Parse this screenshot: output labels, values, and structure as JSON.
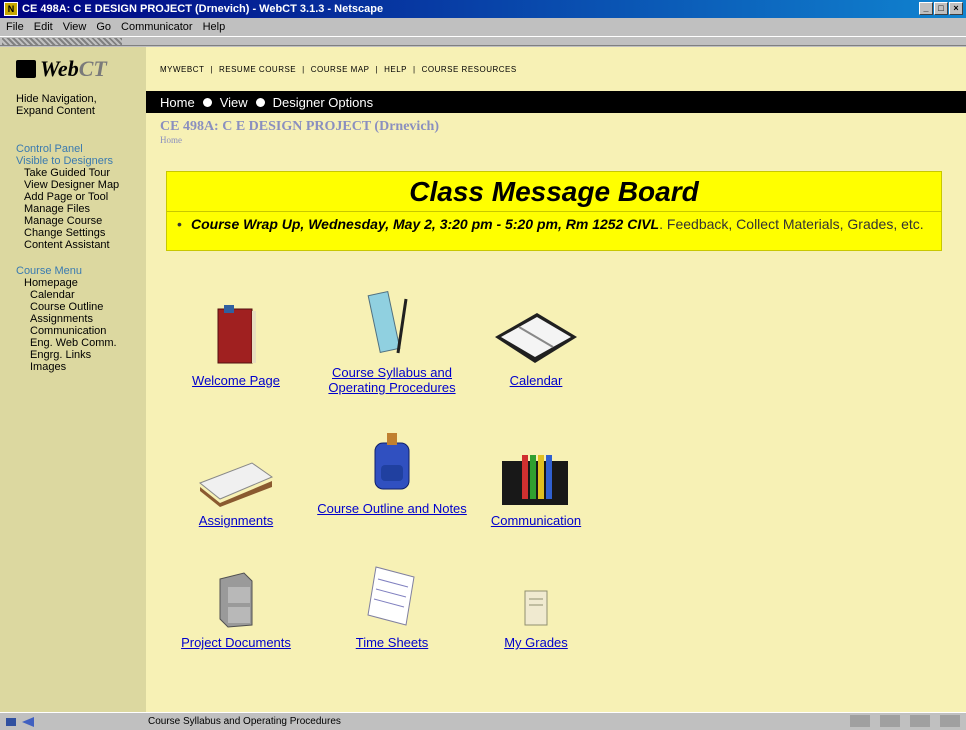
{
  "window": {
    "title": "CE 498A: C E DESIGN PROJECT (Drnevich) - WebCT 3.1.3 - Netscape"
  },
  "menu": [
    "File",
    "Edit",
    "View",
    "Go",
    "Communicator",
    "Help"
  ],
  "logo": {
    "web": "Web",
    "ct": "CT"
  },
  "sidebar": {
    "hide_nav": "Hide Navigation,",
    "expand": "Expand Content",
    "control_panel": "Control Panel",
    "visible": "Visible to Designers",
    "cp_items": [
      "Take Guided Tour",
      "View Designer Map",
      "Add Page or Tool",
      "Manage Files",
      "Manage Course",
      "Change Settings",
      "Content Assistant"
    ],
    "course_menu": "Course Menu",
    "homepage": "Homepage",
    "menu_items": [
      "Calendar",
      "Course Outline",
      "Assignments",
      "Communication",
      "Eng. Web Comm.",
      "Engrg. Links",
      "Images"
    ]
  },
  "topnav": [
    "MYWEBCT",
    "RESUME COURSE",
    "COURSE MAP",
    "HELP",
    "COURSE RESOURCES"
  ],
  "crumbs": {
    "home": "Home",
    "view": "View",
    "designer": "Designer Options"
  },
  "course": {
    "title": "CE 498A: C E DESIGN PROJECT (Drnevich)",
    "home": "Home"
  },
  "board": {
    "title": "Class Message Board",
    "bold": "Course Wrap Up, Wednesday, May 2, 3:20 pm - 5:20 pm, Rm 1252 CIVL",
    "rest": ". Feedback, Collect Materials, Grades, etc."
  },
  "icons": [
    {
      "label": "Welcome Page",
      "icon": "book-icon"
    },
    {
      "label": "Course Syllabus and Operating Procedures",
      "icon": "syllabus-icon"
    },
    {
      "label": "Calendar",
      "icon": "calendar-icon"
    },
    {
      "label": "Assignments",
      "icon": "inbox-tray-icon"
    },
    {
      "label": "Course Outline and Notes",
      "icon": "backpack-icon"
    },
    {
      "label": "Communication",
      "icon": "file-sorter-icon"
    },
    {
      "label": "Project Documents",
      "icon": "file-cabinet-icon"
    },
    {
      "label": "Time Sheets",
      "icon": "notepad-icon"
    },
    {
      "label": "My Grades",
      "icon": "report-icon"
    }
  ],
  "status": {
    "text": "Course Syllabus and Operating Procedures"
  }
}
